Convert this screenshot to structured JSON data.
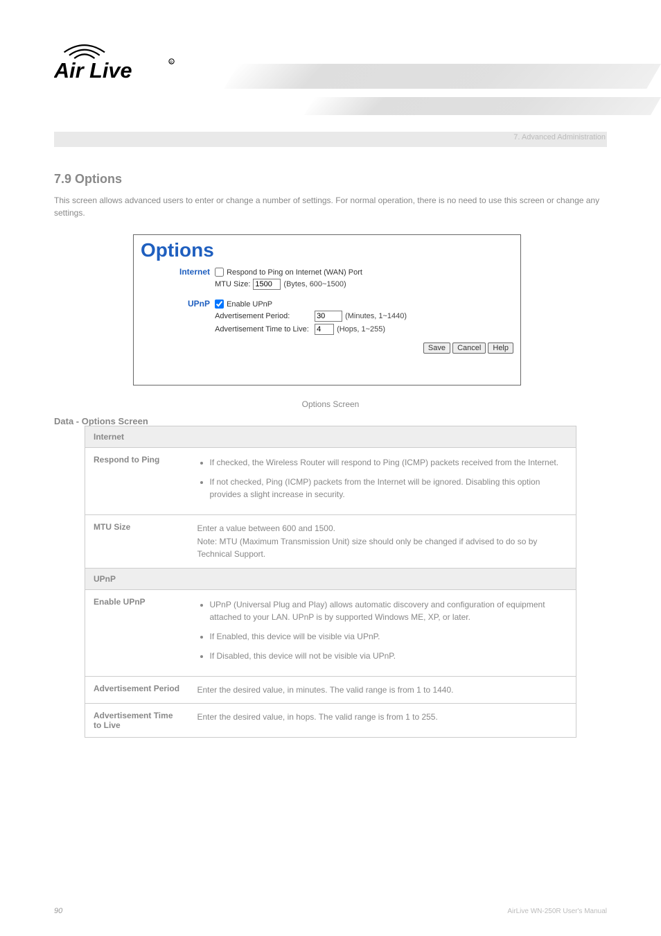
{
  "brand": "Air Live",
  "chapter_line": "7. Advanced Administration",
  "section": {
    "title": "7.9 Options",
    "desc": "This screen allows advanced users to enter or change a number of settings. For normal operation, there is no need to use this screen or change any settings.",
    "figure_caption": "Options Screen",
    "table_title": "Data - Options Screen"
  },
  "panel": {
    "title": "Options",
    "groups": {
      "internet": {
        "label": "Internet",
        "respond_ping_label": "Respond to Ping on Internet (WAN) Port",
        "respond_ping_checked": false,
        "mtu_label": "MTU Size:",
        "mtu_value": "1500",
        "mtu_hint": "(Bytes, 600~1500)"
      },
      "upnp": {
        "label": "UPnP",
        "enable_label": "Enable UPnP",
        "enable_checked": true,
        "adv_period_label": "Advertisement Period:",
        "adv_period_value": "30",
        "adv_period_hint": "(Minutes, 1~1440)",
        "adv_ttl_label": "Advertisement Time to Live:",
        "adv_ttl_value": "4",
        "adv_ttl_hint": "(Hops, 1~255)"
      }
    },
    "buttons": {
      "save": "Save",
      "cancel": "Cancel",
      "help": "Help"
    }
  },
  "table": {
    "internet": {
      "header": "Internet",
      "rows": [
        {
          "label": "Respond to Ping",
          "bullets": [
            "If checked, the Wireless Router will respond to Ping (ICMP) packets received from the Internet.",
            "If not checked, Ping (ICMP) packets from the Internet will be ignored. Disabling this option provides a slight increase in security."
          ]
        },
        {
          "label": "MTU Size",
          "text": "Enter a value between 600 and 1500.\nNote: MTU (Maximum Transmission Unit) size should only be changed if advised to do so by Technical Support."
        }
      ]
    },
    "upnp": {
      "header": "UPnP",
      "rows": [
        {
          "label": "Enable UPnP",
          "bullets": [
            "UPnP (Universal Plug and Play) allows automatic discovery and configuration of equipment attached to your LAN. UPnP is by supported Windows ME, XP, or later.",
            "If Enabled, this device will be visible via UPnP.",
            "If Disabled, this device will not be visible via UPnP."
          ]
        },
        {
          "label": "Advertisement Period",
          "text": "Enter the desired value, in minutes. The valid range is from 1 to 1440."
        },
        {
          "label": "Advertisement Time to Live",
          "text": "Enter the desired value, in hops. The valid range is from 1 to 255."
        }
      ]
    }
  },
  "footer": {
    "page_number": "90",
    "text_line1": "AirLive WN-250R User's Manual"
  }
}
